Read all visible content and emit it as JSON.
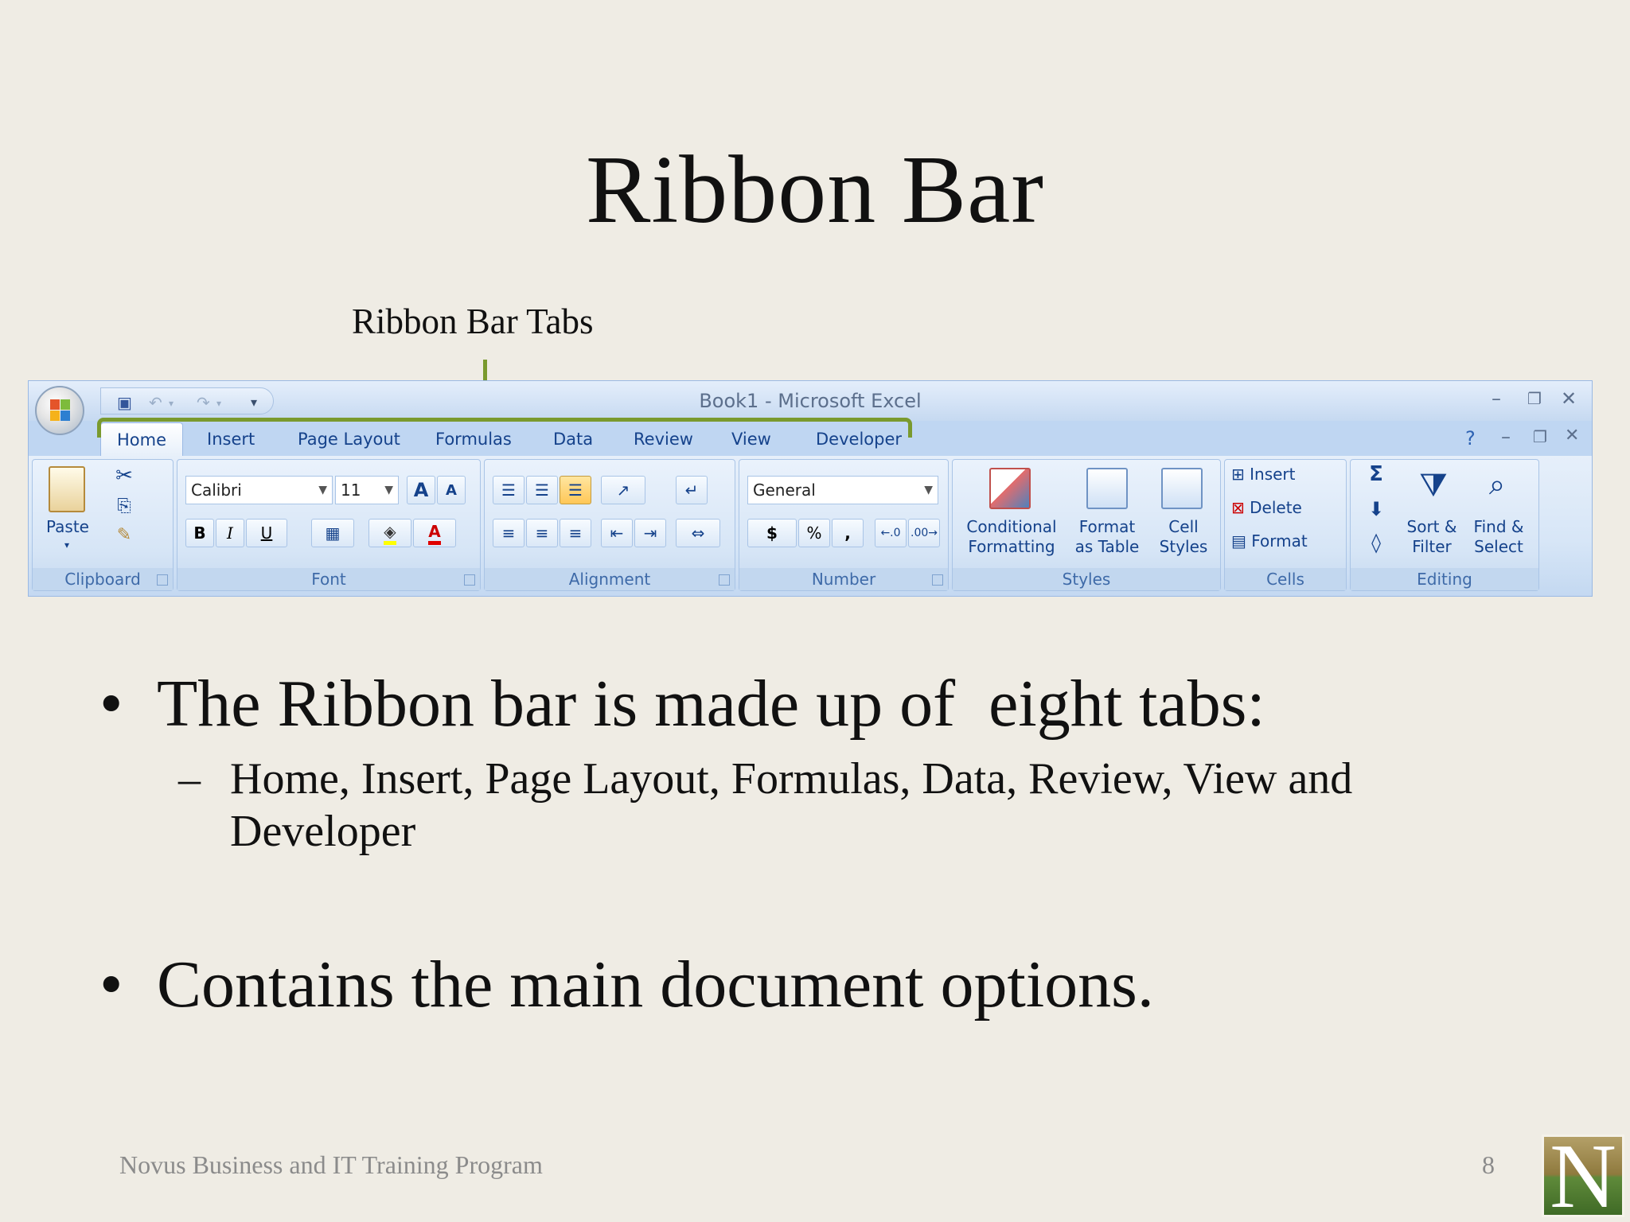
{
  "slide": {
    "title": "Ribbon Bar",
    "callout": "Ribbon Bar Tabs",
    "bullets": [
      "The Ribbon bar is made up of  eight tabs:",
      "Contains the main document options."
    ],
    "sub_bullet": "Home, Insert, Page Layout, Formulas, Data, Review, View and Developer",
    "bullet_char": "•",
    "dash_char": "–",
    "footer": "Novus Business and IT Training Program",
    "page_number": "8",
    "logo_letter": "N"
  },
  "excel": {
    "window_title": "Book1  -  Microsoft Excel",
    "tabs": [
      "Home",
      "Insert",
      "Page Layout",
      "Formulas",
      "Data",
      "Review",
      "View",
      "Developer"
    ],
    "active_tab": "Home",
    "groups": {
      "clipboard": "Clipboard",
      "font": "Font",
      "alignment": "Alignment",
      "number": "Number",
      "styles": "Styles",
      "cells": "Cells",
      "editing": "Editing"
    },
    "paste_label": "Paste",
    "font_name": "Calibri",
    "font_size": "11",
    "number_format": "General",
    "styles_buttons": [
      {
        "line1": "Conditional",
        "line2": "Formatting"
      },
      {
        "line1": "Format",
        "line2": "as Table"
      },
      {
        "line1": "Cell",
        "line2": "Styles"
      }
    ],
    "cells_buttons": [
      "Insert",
      "Delete",
      "Format"
    ],
    "editing_buttons": [
      {
        "line1": "Sort &",
        "line2": "Filter"
      },
      {
        "line1": "Find &",
        "line2": "Select"
      }
    ],
    "font_buttons": {
      "bold": "B",
      "italic": "I",
      "underline": "U",
      "grow": "A",
      "shrink": "A",
      "color": "A"
    },
    "number_buttons": {
      "currency": "$",
      "percent": "%",
      "comma": ","
    },
    "sum_symbol": "Σ"
  }
}
